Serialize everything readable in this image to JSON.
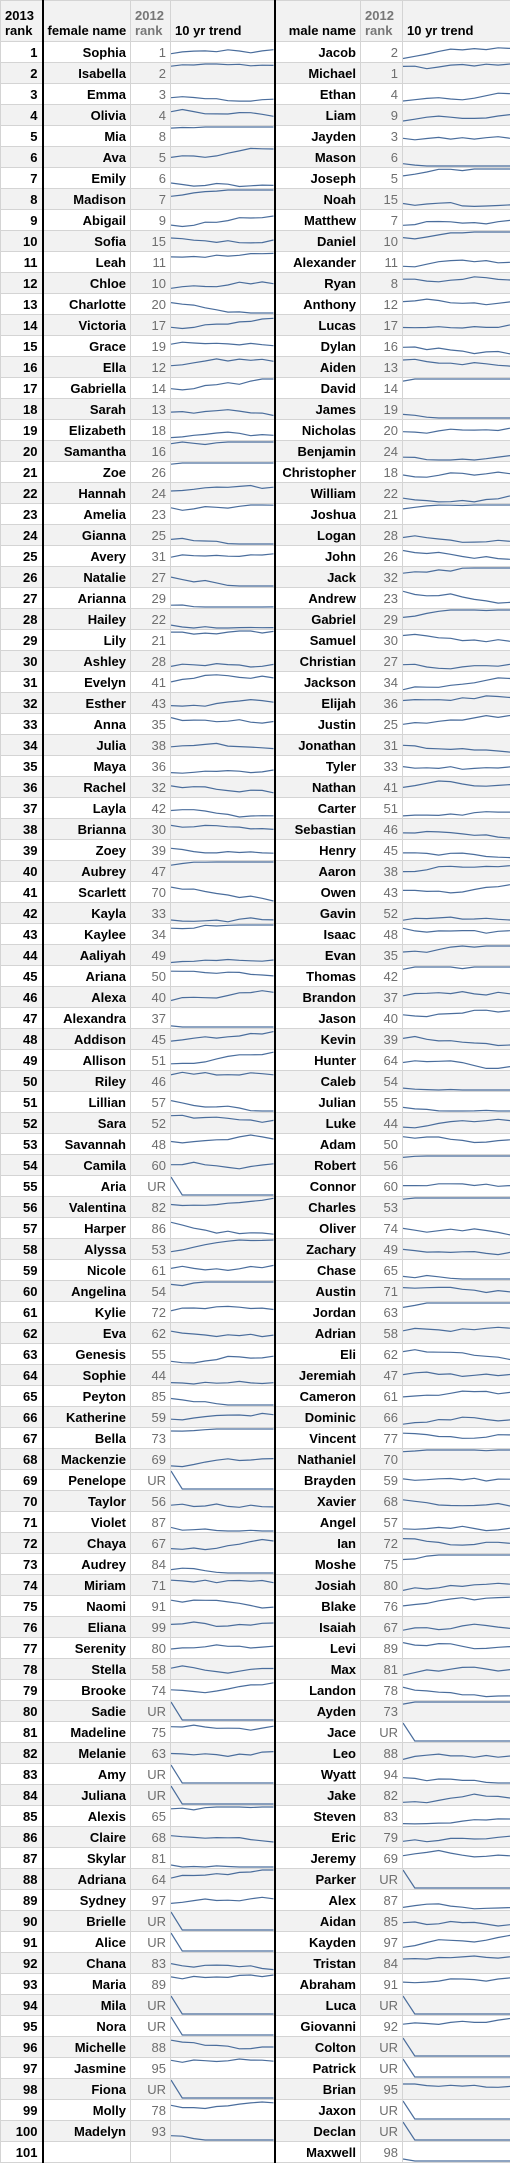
{
  "headers": {
    "rank_2013": "2013\nrank",
    "rank_2013_line1": "2013",
    "rank_2013_line2": "rank",
    "female_name": "female name",
    "rank_2012_line1": "2012",
    "rank_2012_line2": "rank",
    "trend": "10 yr trend",
    "male_name": "male name"
  },
  "colors": {
    "trend_line": "#4a6d9c",
    "row_alt": "#f2f2f2",
    "prev_rank_text": "#6e6e6e"
  },
  "rows": [
    {
      "rank": "1",
      "female": "Sophia",
      "female_prev": "1",
      "male": "Jacob",
      "male_prev": "2"
    },
    {
      "rank": "2",
      "female": "Isabella",
      "female_prev": "2",
      "male": "Michael",
      "male_prev": "1"
    },
    {
      "rank": "3",
      "female": "Emma",
      "female_prev": "3",
      "male": "Ethan",
      "male_prev": "4"
    },
    {
      "rank": "4",
      "female": "Olivia",
      "female_prev": "4",
      "male": "Liam",
      "male_prev": "9"
    },
    {
      "rank": "5",
      "female": "Mia",
      "female_prev": "8",
      "male": "Jayden",
      "male_prev": "3"
    },
    {
      "rank": "6",
      "female": "Ava",
      "female_prev": "5",
      "male": "Mason",
      "male_prev": "6"
    },
    {
      "rank": "7",
      "female": "Emily",
      "female_prev": "6",
      "male": "Joseph",
      "male_prev": "5"
    },
    {
      "rank": "8",
      "female": "Madison",
      "female_prev": "7",
      "male": "Noah",
      "male_prev": "15"
    },
    {
      "rank": "9",
      "female": "Abigail",
      "female_prev": "9",
      "male": "Matthew",
      "male_prev": "7"
    },
    {
      "rank": "10",
      "female": "Sofia",
      "female_prev": "15",
      "male": "Daniel",
      "male_prev": "10"
    },
    {
      "rank": "11",
      "female": "Leah",
      "female_prev": "11",
      "male": "Alexander",
      "male_prev": "11"
    },
    {
      "rank": "12",
      "female": "Chloe",
      "female_prev": "10",
      "male": "Ryan",
      "male_prev": "8"
    },
    {
      "rank": "13",
      "female": "Charlotte",
      "female_prev": "20",
      "male": "Anthony",
      "male_prev": "12"
    },
    {
      "rank": "14",
      "female": "Victoria",
      "female_prev": "17",
      "male": "Lucas",
      "male_prev": "17"
    },
    {
      "rank": "15",
      "female": "Grace",
      "female_prev": "19",
      "male": "Dylan",
      "male_prev": "16"
    },
    {
      "rank": "16",
      "female": "Ella",
      "female_prev": "12",
      "male": "Aiden",
      "male_prev": "13"
    },
    {
      "rank": "17",
      "female": "Gabriella",
      "female_prev": "14",
      "male": "David",
      "male_prev": "14"
    },
    {
      "rank": "18",
      "female": "Sarah",
      "female_prev": "13",
      "male": "James",
      "male_prev": "19"
    },
    {
      "rank": "19",
      "female": "Elizabeth",
      "female_prev": "18",
      "male": "Nicholas",
      "male_prev": "20"
    },
    {
      "rank": "20",
      "female": "Samantha",
      "female_prev": "16",
      "male": "Benjamin",
      "male_prev": "24"
    },
    {
      "rank": "21",
      "female": "Zoe",
      "female_prev": "26",
      "male": "Christopher",
      "male_prev": "18"
    },
    {
      "rank": "22",
      "female": "Hannah",
      "female_prev": "24",
      "male": "William",
      "male_prev": "22"
    },
    {
      "rank": "23",
      "female": "Amelia",
      "female_prev": "23",
      "male": "Joshua",
      "male_prev": "21"
    },
    {
      "rank": "24",
      "female": "Gianna",
      "female_prev": "25",
      "male": "Logan",
      "male_prev": "28"
    },
    {
      "rank": "25",
      "female": "Avery",
      "female_prev": "31",
      "male": "John",
      "male_prev": "26"
    },
    {
      "rank": "26",
      "female": "Natalie",
      "female_prev": "27",
      "male": "Jack",
      "male_prev": "32"
    },
    {
      "rank": "27",
      "female": "Arianna",
      "female_prev": "29",
      "male": "Andrew",
      "male_prev": "23"
    },
    {
      "rank": "28",
      "female": "Hailey",
      "female_prev": "22",
      "male": "Gabriel",
      "male_prev": "29"
    },
    {
      "rank": "29",
      "female": "Lily",
      "female_prev": "21",
      "male": "Samuel",
      "male_prev": "30"
    },
    {
      "rank": "30",
      "female": "Ashley",
      "female_prev": "28",
      "male": "Christian",
      "male_prev": "27"
    },
    {
      "rank": "31",
      "female": "Evelyn",
      "female_prev": "41",
      "male": "Jackson",
      "male_prev": "34"
    },
    {
      "rank": "32",
      "female": "Esther",
      "female_prev": "43",
      "male": "Elijah",
      "male_prev": "36"
    },
    {
      "rank": "33",
      "female": "Anna",
      "female_prev": "35",
      "male": "Justin",
      "male_prev": "25"
    },
    {
      "rank": "34",
      "female": "Julia",
      "female_prev": "38",
      "male": "Jonathan",
      "male_prev": "31"
    },
    {
      "rank": "35",
      "female": "Maya",
      "female_prev": "36",
      "male": "Tyler",
      "male_prev": "33"
    },
    {
      "rank": "36",
      "female": "Rachel",
      "female_prev": "32",
      "male": "Nathan",
      "male_prev": "41"
    },
    {
      "rank": "37",
      "female": "Layla",
      "female_prev": "42",
      "male": "Carter",
      "male_prev": "51"
    },
    {
      "rank": "38",
      "female": "Brianna",
      "female_prev": "30",
      "male": "Sebastian",
      "male_prev": "46"
    },
    {
      "rank": "39",
      "female": "Zoey",
      "female_prev": "39",
      "male": "Henry",
      "male_prev": "45"
    },
    {
      "rank": "40",
      "female": "Aubrey",
      "female_prev": "47",
      "male": "Aaron",
      "male_prev": "38"
    },
    {
      "rank": "41",
      "female": "Scarlett",
      "female_prev": "70",
      "male": "Owen",
      "male_prev": "43"
    },
    {
      "rank": "42",
      "female": "Kayla",
      "female_prev": "33",
      "male": "Gavin",
      "male_prev": "52"
    },
    {
      "rank": "43",
      "female": "Kaylee",
      "female_prev": "34",
      "male": "Isaac",
      "male_prev": "48"
    },
    {
      "rank": "44",
      "female": "Aaliyah",
      "female_prev": "49",
      "male": "Evan",
      "male_prev": "35"
    },
    {
      "rank": "45",
      "female": "Ariana",
      "female_prev": "50",
      "male": "Thomas",
      "male_prev": "42"
    },
    {
      "rank": "46",
      "female": "Alexa",
      "female_prev": "40",
      "male": "Brandon",
      "male_prev": "37"
    },
    {
      "rank": "47",
      "female": "Alexandra",
      "female_prev": "37",
      "male": "Jason",
      "male_prev": "40"
    },
    {
      "rank": "48",
      "female": "Addison",
      "female_prev": "45",
      "male": "Kevin",
      "male_prev": "39"
    },
    {
      "rank": "49",
      "female": "Allison",
      "female_prev": "51",
      "male": "Hunter",
      "male_prev": "64"
    },
    {
      "rank": "50",
      "female": "Riley",
      "female_prev": "46",
      "male": "Caleb",
      "male_prev": "54"
    },
    {
      "rank": "51",
      "female": "Lillian",
      "female_prev": "57",
      "male": "Julian",
      "male_prev": "55"
    },
    {
      "rank": "52",
      "female": "Sara",
      "female_prev": "52",
      "male": "Luke",
      "male_prev": "44"
    },
    {
      "rank": "53",
      "female": "Savannah",
      "female_prev": "48",
      "male": "Adam",
      "male_prev": "50"
    },
    {
      "rank": "54",
      "female": "Camila",
      "female_prev": "60",
      "male": "Robert",
      "male_prev": "56"
    },
    {
      "rank": "55",
      "female": "Aria",
      "female_prev": "UR",
      "male": "Connor",
      "male_prev": "60"
    },
    {
      "rank": "56",
      "female": "Valentina",
      "female_prev": "82",
      "male": "Charles",
      "male_prev": "53"
    },
    {
      "rank": "57",
      "female": "Harper",
      "female_prev": "86",
      "male": "Oliver",
      "male_prev": "74"
    },
    {
      "rank": "58",
      "female": "Alyssa",
      "female_prev": "53",
      "male": "Zachary",
      "male_prev": "49"
    },
    {
      "rank": "59",
      "female": "Nicole",
      "female_prev": "61",
      "male": "Chase",
      "male_prev": "65"
    },
    {
      "rank": "60",
      "female": "Angelina",
      "female_prev": "54",
      "male": "Austin",
      "male_prev": "71"
    },
    {
      "rank": "61",
      "female": "Kylie",
      "female_prev": "72",
      "male": "Jordan",
      "male_prev": "63"
    },
    {
      "rank": "62",
      "female": "Eva",
      "female_prev": "62",
      "male": "Adrian",
      "male_prev": "58"
    },
    {
      "rank": "63",
      "female": "Genesis",
      "female_prev": "55",
      "male": "Eli",
      "male_prev": "62"
    },
    {
      "rank": "64",
      "female": "Sophie",
      "female_prev": "44",
      "male": "Jeremiah",
      "male_prev": "47"
    },
    {
      "rank": "65",
      "female": "Peyton",
      "female_prev": "85",
      "male": "Cameron",
      "male_prev": "61"
    },
    {
      "rank": "66",
      "female": "Katherine",
      "female_prev": "59",
      "male": "Dominic",
      "male_prev": "66"
    },
    {
      "rank": "67",
      "female": "Bella",
      "female_prev": "73",
      "male": "Vincent",
      "male_prev": "77"
    },
    {
      "rank": "68",
      "female": "Mackenzie",
      "female_prev": "69",
      "male": "Nathaniel",
      "male_prev": "70"
    },
    {
      "rank": "69",
      "female": "Penelope",
      "female_prev": "UR",
      "male": "Brayden",
      "male_prev": "59"
    },
    {
      "rank": "70",
      "female": "Taylor",
      "female_prev": "56",
      "male": "Xavier",
      "male_prev": "68"
    },
    {
      "rank": "71",
      "female": "Violet",
      "female_prev": "87",
      "male": "Angel",
      "male_prev": "57"
    },
    {
      "rank": "72",
      "female": "Chaya",
      "female_prev": "67",
      "male": "Ian",
      "male_prev": "72"
    },
    {
      "rank": "73",
      "female": "Audrey",
      "female_prev": "84",
      "male": "Moshe",
      "male_prev": "75"
    },
    {
      "rank": "74",
      "female": "Miriam",
      "female_prev": "71",
      "male": "Josiah",
      "male_prev": "80"
    },
    {
      "rank": "75",
      "female": "Naomi",
      "female_prev": "91",
      "male": "Blake",
      "male_prev": "76"
    },
    {
      "rank": "76",
      "female": "Eliana",
      "female_prev": "99",
      "male": "Isaiah",
      "male_prev": "67"
    },
    {
      "rank": "77",
      "female": "Serenity",
      "female_prev": "80",
      "male": "Levi",
      "male_prev": "89"
    },
    {
      "rank": "78",
      "female": "Stella",
      "female_prev": "58",
      "male": "Max",
      "male_prev": "81"
    },
    {
      "rank": "79",
      "female": "Brooke",
      "female_prev": "74",
      "male": "Landon",
      "male_prev": "78"
    },
    {
      "rank": "80",
      "female": "Sadie",
      "female_prev": "UR",
      "male": "Ayden",
      "male_prev": "73"
    },
    {
      "rank": "81",
      "female": "Madeline",
      "female_prev": "75",
      "male": "Jace",
      "male_prev": "UR"
    },
    {
      "rank": "82",
      "female": "Melanie",
      "female_prev": "63",
      "male": "Leo",
      "male_prev": "88"
    },
    {
      "rank": "83",
      "female": "Amy",
      "female_prev": "UR",
      "male": "Wyatt",
      "male_prev": "94"
    },
    {
      "rank": "84",
      "female": "Juliana",
      "female_prev": "UR",
      "male": "Jake",
      "male_prev": "82"
    },
    {
      "rank": "85",
      "female": "Alexis",
      "female_prev": "65",
      "male": "Steven",
      "male_prev": "83"
    },
    {
      "rank": "86",
      "female": "Claire",
      "female_prev": "68",
      "male": "Eric",
      "male_prev": "79"
    },
    {
      "rank": "87",
      "female": "Skylar",
      "female_prev": "81",
      "male": "Jeremy",
      "male_prev": "69"
    },
    {
      "rank": "88",
      "female": "Adriana",
      "female_prev": "64",
      "male": "Parker",
      "male_prev": "UR"
    },
    {
      "rank": "89",
      "female": "Sydney",
      "female_prev": "97",
      "male": "Alex",
      "male_prev": "87"
    },
    {
      "rank": "90",
      "female": "Brielle",
      "female_prev": "UR",
      "male": "Aidan",
      "male_prev": "85"
    },
    {
      "rank": "91",
      "female": "Alice",
      "female_prev": "UR",
      "male": "Kayden",
      "male_prev": "97"
    },
    {
      "rank": "92",
      "female": "Chana",
      "female_prev": "83",
      "male": "Tristan",
      "male_prev": "84"
    },
    {
      "rank": "93",
      "female": "Maria",
      "female_prev": "89",
      "male": "Abraham",
      "male_prev": "91"
    },
    {
      "rank": "94",
      "female": "Mila",
      "female_prev": "UR",
      "male": "Luca",
      "male_prev": "UR"
    },
    {
      "rank": "95",
      "female": "Nora",
      "female_prev": "UR",
      "male": "Giovanni",
      "male_prev": "92"
    },
    {
      "rank": "96",
      "female": "Michelle",
      "female_prev": "88",
      "male": "Colton",
      "male_prev": "UR"
    },
    {
      "rank": "97",
      "female": "Jasmine",
      "female_prev": "95",
      "male": "Patrick",
      "male_prev": "UR"
    },
    {
      "rank": "98",
      "female": "Fiona",
      "female_prev": "UR",
      "male": "Brian",
      "male_prev": "95"
    },
    {
      "rank": "99",
      "female": "Molly",
      "female_prev": "78",
      "male": "Jaxon",
      "male_prev": "UR"
    },
    {
      "rank": "100",
      "female": "Madelyn",
      "female_prev": "93",
      "male": "Declan",
      "male_prev": "UR"
    },
    {
      "rank": "101",
      "female": "",
      "female_prev": "",
      "male": "Maxwell",
      "male_prev": "98"
    }
  ]
}
